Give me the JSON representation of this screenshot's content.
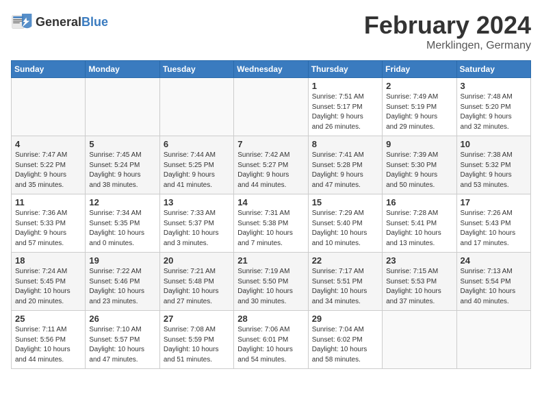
{
  "header": {
    "logo_general": "General",
    "logo_blue": "Blue",
    "month_title": "February 2024",
    "location": "Merklingen, Germany"
  },
  "weekdays": [
    "Sunday",
    "Monday",
    "Tuesday",
    "Wednesday",
    "Thursday",
    "Friday",
    "Saturday"
  ],
  "weeks": [
    [
      {
        "day": "",
        "info": ""
      },
      {
        "day": "",
        "info": ""
      },
      {
        "day": "",
        "info": ""
      },
      {
        "day": "",
        "info": ""
      },
      {
        "day": "1",
        "info": "Sunrise: 7:51 AM\nSunset: 5:17 PM\nDaylight: 9 hours\nand 26 minutes."
      },
      {
        "day": "2",
        "info": "Sunrise: 7:49 AM\nSunset: 5:19 PM\nDaylight: 9 hours\nand 29 minutes."
      },
      {
        "day": "3",
        "info": "Sunrise: 7:48 AM\nSunset: 5:20 PM\nDaylight: 9 hours\nand 32 minutes."
      }
    ],
    [
      {
        "day": "4",
        "info": "Sunrise: 7:47 AM\nSunset: 5:22 PM\nDaylight: 9 hours\nand 35 minutes."
      },
      {
        "day": "5",
        "info": "Sunrise: 7:45 AM\nSunset: 5:24 PM\nDaylight: 9 hours\nand 38 minutes."
      },
      {
        "day": "6",
        "info": "Sunrise: 7:44 AM\nSunset: 5:25 PM\nDaylight: 9 hours\nand 41 minutes."
      },
      {
        "day": "7",
        "info": "Sunrise: 7:42 AM\nSunset: 5:27 PM\nDaylight: 9 hours\nand 44 minutes."
      },
      {
        "day": "8",
        "info": "Sunrise: 7:41 AM\nSunset: 5:28 PM\nDaylight: 9 hours\nand 47 minutes."
      },
      {
        "day": "9",
        "info": "Sunrise: 7:39 AM\nSunset: 5:30 PM\nDaylight: 9 hours\nand 50 minutes."
      },
      {
        "day": "10",
        "info": "Sunrise: 7:38 AM\nSunset: 5:32 PM\nDaylight: 9 hours\nand 53 minutes."
      }
    ],
    [
      {
        "day": "11",
        "info": "Sunrise: 7:36 AM\nSunset: 5:33 PM\nDaylight: 9 hours\nand 57 minutes."
      },
      {
        "day": "12",
        "info": "Sunrise: 7:34 AM\nSunset: 5:35 PM\nDaylight: 10 hours\nand 0 minutes."
      },
      {
        "day": "13",
        "info": "Sunrise: 7:33 AM\nSunset: 5:37 PM\nDaylight: 10 hours\nand 3 minutes."
      },
      {
        "day": "14",
        "info": "Sunrise: 7:31 AM\nSunset: 5:38 PM\nDaylight: 10 hours\nand 7 minutes."
      },
      {
        "day": "15",
        "info": "Sunrise: 7:29 AM\nSunset: 5:40 PM\nDaylight: 10 hours\nand 10 minutes."
      },
      {
        "day": "16",
        "info": "Sunrise: 7:28 AM\nSunset: 5:41 PM\nDaylight: 10 hours\nand 13 minutes."
      },
      {
        "day": "17",
        "info": "Sunrise: 7:26 AM\nSunset: 5:43 PM\nDaylight: 10 hours\nand 17 minutes."
      }
    ],
    [
      {
        "day": "18",
        "info": "Sunrise: 7:24 AM\nSunset: 5:45 PM\nDaylight: 10 hours\nand 20 minutes."
      },
      {
        "day": "19",
        "info": "Sunrise: 7:22 AM\nSunset: 5:46 PM\nDaylight: 10 hours\nand 23 minutes."
      },
      {
        "day": "20",
        "info": "Sunrise: 7:21 AM\nSunset: 5:48 PM\nDaylight: 10 hours\nand 27 minutes."
      },
      {
        "day": "21",
        "info": "Sunrise: 7:19 AM\nSunset: 5:50 PM\nDaylight: 10 hours\nand 30 minutes."
      },
      {
        "day": "22",
        "info": "Sunrise: 7:17 AM\nSunset: 5:51 PM\nDaylight: 10 hours\nand 34 minutes."
      },
      {
        "day": "23",
        "info": "Sunrise: 7:15 AM\nSunset: 5:53 PM\nDaylight: 10 hours\nand 37 minutes."
      },
      {
        "day": "24",
        "info": "Sunrise: 7:13 AM\nSunset: 5:54 PM\nDaylight: 10 hours\nand 40 minutes."
      }
    ],
    [
      {
        "day": "25",
        "info": "Sunrise: 7:11 AM\nSunset: 5:56 PM\nDaylight: 10 hours\nand 44 minutes."
      },
      {
        "day": "26",
        "info": "Sunrise: 7:10 AM\nSunset: 5:57 PM\nDaylight: 10 hours\nand 47 minutes."
      },
      {
        "day": "27",
        "info": "Sunrise: 7:08 AM\nSunset: 5:59 PM\nDaylight: 10 hours\nand 51 minutes."
      },
      {
        "day": "28",
        "info": "Sunrise: 7:06 AM\nSunset: 6:01 PM\nDaylight: 10 hours\nand 54 minutes."
      },
      {
        "day": "29",
        "info": "Sunrise: 7:04 AM\nSunset: 6:02 PM\nDaylight: 10 hours\nand 58 minutes."
      },
      {
        "day": "",
        "info": ""
      },
      {
        "day": "",
        "info": ""
      }
    ]
  ]
}
